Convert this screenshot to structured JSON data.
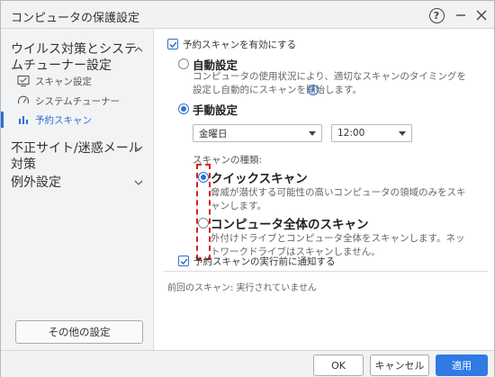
{
  "window": {
    "title": "コンピュータの保護設定"
  },
  "sidebar": {
    "sections": [
      {
        "label": "ウイルス対策とシステムチューナー設定"
      },
      {
        "label": "不正サイト/迷惑メール対策"
      },
      {
        "label": "例外設定"
      }
    ],
    "items": [
      {
        "label": "スキャン設定",
        "icon": "scan-settings-icon"
      },
      {
        "label": "システムチューナー",
        "icon": "gauge-icon"
      },
      {
        "label": "予約スキャン",
        "icon": "bar-chart-icon"
      }
    ],
    "other_settings_label": "その他の設定"
  },
  "main": {
    "enable_scheduled_label": "予約スキャンを有効にする",
    "enable_scheduled_checked": true,
    "auto": {
      "title": "自動設定",
      "description": "コンピュータの使用状況により、適切なスキャンのタイミングを設定し自動的にスキャンを開始します。",
      "selected": false
    },
    "manual": {
      "title": "手動設定",
      "selected": true,
      "day_value": "金曜日",
      "time_value": "12:00"
    },
    "scan_type_label": "スキャンの種類:",
    "quick_scan": {
      "title": "クイックスキャン",
      "description": "脅威が潜伏する可能性の高いコンピュータの領域のみをスキャンします。",
      "selected": true
    },
    "full_scan": {
      "title": "コンピュータ全体のスキャン",
      "description": "外付けドライブとコンピュータ全体をスキャンします。ネットワークドライブはスキャンしません。",
      "selected": false
    },
    "notify_label": "予約スキャンの実行前に通知する",
    "notify_checked": true,
    "last_scan_text": "前回のスキャン: 実行されていません"
  },
  "footer": {
    "ok_label": "OK",
    "cancel_label": "キャンセル",
    "apply_label": "適用"
  },
  "colors": {
    "accent": "#2f6fcf",
    "highlight_box": "#d62020"
  }
}
